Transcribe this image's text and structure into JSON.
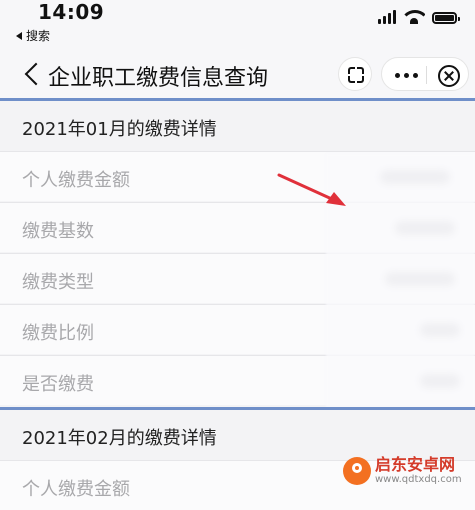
{
  "status_bar": {
    "time": "14:09",
    "back_app_label": "搜索"
  },
  "nav": {
    "title": "企业职工缴费信息查询"
  },
  "sections": [
    {
      "heading": "2021年01月的缴费详情",
      "rows": [
        {
          "label": "个人缴费金额"
        },
        {
          "label": "缴费基数"
        },
        {
          "label": "缴费类型"
        },
        {
          "label": "缴费比例"
        },
        {
          "label": "是否缴费"
        }
      ]
    },
    {
      "heading": "2021年02月的缴费详情",
      "rows": [
        {
          "label": "个人缴费金额"
        }
      ]
    }
  ],
  "watermark": {
    "name": "启东安卓网",
    "url": "www.qdtxdq.com"
  },
  "colors": {
    "accent_line": "#6f8fc9",
    "arrow": "#e0303a",
    "watermark": "#f37021"
  }
}
